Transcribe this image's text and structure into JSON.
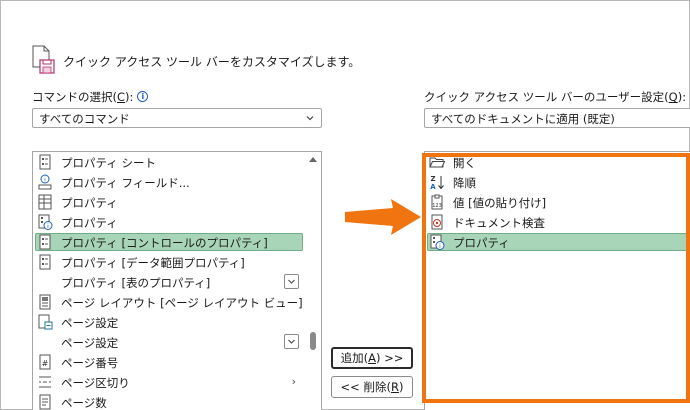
{
  "header": {
    "title": "クイック アクセス ツール バーをカスタマイズします。",
    "icon": "customize-toolbar-icon"
  },
  "left": {
    "label_prefix": "コマンドの選択(",
    "label_key": "C",
    "label_suffix": "):",
    "dropdown_value": "すべてのコマンド",
    "items": [
      {
        "label": "プロパティ シート",
        "icon": "property-sheet-icon"
      },
      {
        "label": "プロパティ フィールド...",
        "icon": "property-field-icon"
      },
      {
        "label": "プロパティ",
        "icon": "properties-grid-icon"
      },
      {
        "label": "プロパティ",
        "icon": "properties-info-icon"
      },
      {
        "label": "プロパティ [コントロールのプロパティ]",
        "icon": "control-properties-icon",
        "selected": true
      },
      {
        "label": "プロパティ [データ範囲プロパティ]",
        "icon": "data-range-properties-icon"
      },
      {
        "label": "プロパティ [表のプロパティ]",
        "icon": "",
        "submenu": "button"
      },
      {
        "label": "ページ レイアウト [ページ レイアウト ビュー]",
        "icon": "page-layout-icon"
      },
      {
        "label": "ページ設定",
        "icon": "page-setup-icon"
      },
      {
        "label": "ページ設定",
        "icon": "",
        "submenu": "button"
      },
      {
        "label": "ページ番号",
        "icon": "page-number-icon"
      },
      {
        "label": "ページ区切り",
        "icon": "page-break-icon",
        "submenu": "arrow"
      },
      {
        "label": "ページ数",
        "icon": "page-count-icon"
      }
    ]
  },
  "right": {
    "label_prefix": "クイック アクセス ツール バーのユーザー設定(",
    "label_key": "Q",
    "label_suffix": "):",
    "dropdown_value": "すべてのドキュメントに適用 (既定)",
    "items": [
      {
        "label": "開く",
        "icon": "open-folder-icon"
      },
      {
        "label": "降順",
        "icon": "sort-descending-icon"
      },
      {
        "label": "値 [値の貼り付け]",
        "icon": "paste-values-icon"
      },
      {
        "label": "ドキュメント検査",
        "icon": "inspect-document-icon"
      },
      {
        "label": "プロパティ",
        "icon": "properties-info-icon",
        "selected": true
      }
    ]
  },
  "buttons": {
    "add_prefix": "追加(",
    "add_key": "A",
    "add_suffix": ") >>",
    "remove_prefix": "<< 削除(",
    "remove_key": "R",
    "remove_suffix": ")"
  },
  "colors": {
    "accent_orange": "#f07410",
    "selection_green": "#a8d5b7",
    "info_blue": "#1f5fbf"
  }
}
